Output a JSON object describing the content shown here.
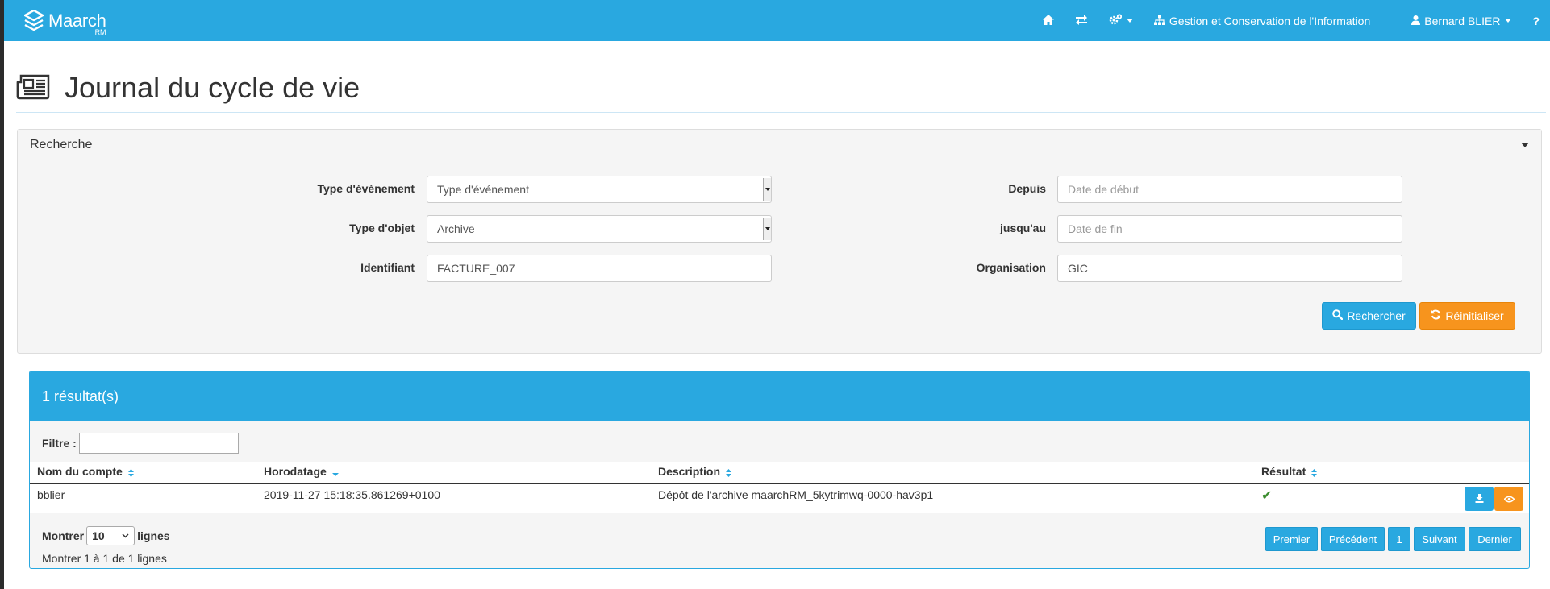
{
  "navbar": {
    "brand_name": "Maarch",
    "brand_sub": "RM",
    "org_label": "Gestion et Conservation de l'Information",
    "user_label": "Bernard BLIER",
    "help_label": "?"
  },
  "header": {
    "title": "Journal du cycle de vie"
  },
  "search": {
    "panel_title": "Recherche",
    "event_type": {
      "label": "Type d'événement",
      "value": "Type d'événement"
    },
    "object_type": {
      "label": "Type d'objet",
      "value": "Archive"
    },
    "identifier": {
      "label": "Identifiant",
      "value": "FACTURE_007"
    },
    "since": {
      "label": "Depuis",
      "placeholder": "Date de début"
    },
    "until": {
      "label": "jusqu'au",
      "placeholder": "Date de fin"
    },
    "organization": {
      "label": "Organisation",
      "value": "GIC"
    },
    "search_button": "Rechercher",
    "reset_button": "Réinitialiser"
  },
  "results": {
    "title": "1 résultat(s)",
    "filter_label": "Filtre :",
    "columns": [
      "Nom du compte",
      "Horodatage",
      "Description",
      "Résultat"
    ],
    "rows": [
      {
        "account": "bblier",
        "timestamp": "2019-11-27 15:18:35.861269+0100",
        "description": "Dépôt de l'archive maarchRM_5kytrimwq-0000-hav3p1",
        "result": "✔"
      }
    ],
    "show_label": "Montrer",
    "page_length": "10",
    "lines_label": "lignes",
    "info": "Montrer 1 à 1 de 1 lignes",
    "pagination": {
      "first": "Premier",
      "previous": "Précédent",
      "current": "1",
      "next": "Suivant",
      "last": "Dernier"
    }
  },
  "colors": {
    "primary": "#29a8e0",
    "warning": "#f7941d",
    "success": "#3c8d2f"
  },
  "icons": [
    "maarch-logo-icon",
    "home-icon",
    "exchange-icon",
    "cogs-icon",
    "sitemap-icon",
    "user-icon",
    "newspaper-icon",
    "search-icon",
    "refresh-icon",
    "sort-icon",
    "check-icon",
    "download-icon",
    "eye-icon"
  ]
}
